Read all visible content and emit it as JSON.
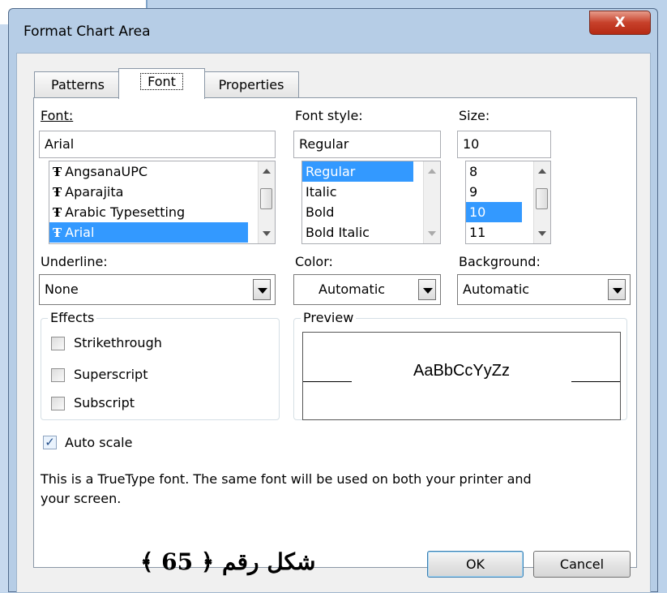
{
  "window": {
    "title": "Format Chart Area",
    "close_glyph": "X"
  },
  "tabs": [
    {
      "label": "Patterns",
      "active": false
    },
    {
      "label": "Font",
      "active": true
    },
    {
      "label": "Properties",
      "active": false
    }
  ],
  "font": {
    "label": "Font:",
    "value": "Arial",
    "items": [
      "AngsanaUPC",
      "Aparajita",
      "Arabic Typesetting",
      "Arial"
    ],
    "tt_glyph": "Ŧ"
  },
  "style": {
    "label": "Font style:",
    "value": "Regular",
    "items": [
      "Regular",
      "Italic",
      "Bold",
      "Bold Italic"
    ]
  },
  "size": {
    "label": "Size:",
    "value": "10",
    "items": [
      "8",
      "9",
      "10",
      "11"
    ]
  },
  "underline": {
    "label": "Underline:",
    "value": "None"
  },
  "color": {
    "label": "Color:",
    "value": "Automatic"
  },
  "background": {
    "label": "Background:",
    "value": "Automatic"
  },
  "effects": {
    "title": "Effects",
    "strikethrough": "Strikethrough",
    "superscript": "Superscript",
    "subscript": "Subscript"
  },
  "preview": {
    "title": "Preview",
    "sample": "AaBbCcYyZz"
  },
  "auto_scale": {
    "label": "Auto scale",
    "checked": true,
    "check_glyph": "✓"
  },
  "info_line1": "This is a TrueType font.  The same font will be used on both your printer and",
  "info_line2": "your screen.",
  "buttons": {
    "ok": "OK",
    "cancel": "Cancel"
  },
  "caption": "شكل رقم ﴿ 65 ﴾"
}
